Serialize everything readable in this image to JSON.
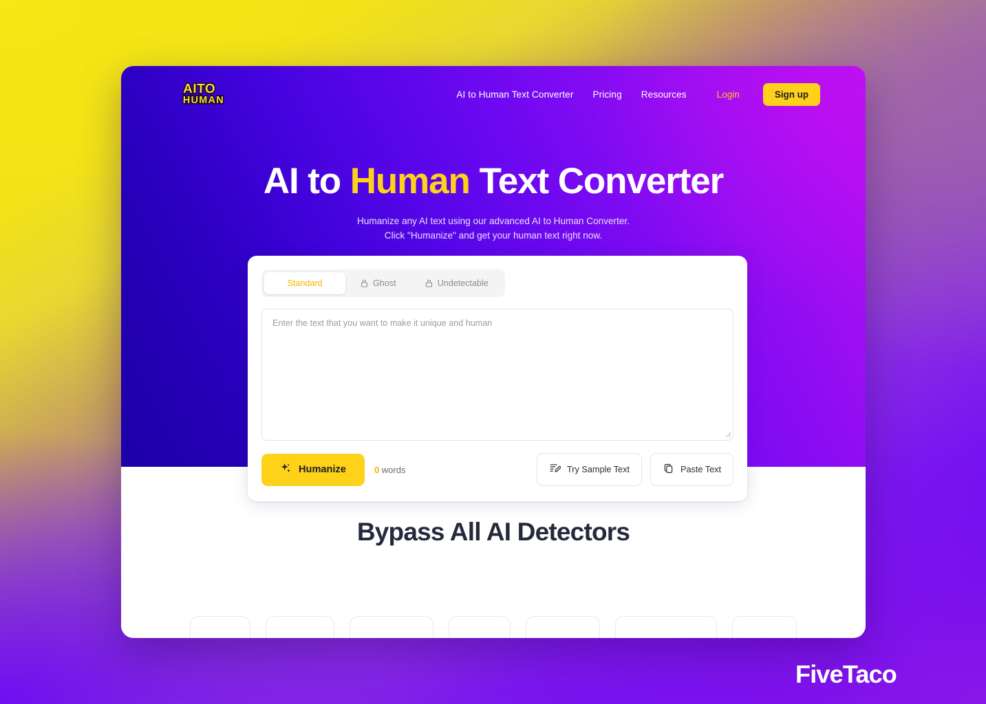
{
  "background": {
    "gradient_from": "#f2e317",
    "gradient_to": "#6205ef"
  },
  "watermark": {
    "text": "FiveTaco"
  },
  "site": {
    "logo": {
      "line1": "AITO",
      "line2": "HUMAN",
      "color": "#ffd83a"
    },
    "nav": {
      "links": [
        {
          "label": "AI to Human Text Converter"
        },
        {
          "label": "Pricing"
        },
        {
          "label": "Resources"
        }
      ],
      "login_label": "Login",
      "signup_label": "Sign up",
      "accent_color": "#ffd21a"
    }
  },
  "hero": {
    "heading_part1": "AI to ",
    "heading_highlight": "Human",
    "heading_part2": " Text Converter",
    "highlight_color": "#ffd21a",
    "subtitle_line1": "Humanize any AI text using our advanced AI to Human Converter.",
    "subtitle_line2": "Click \"Humanize\" and get your human text right now."
  },
  "converter": {
    "tabs": [
      {
        "label": "Standard",
        "locked": false,
        "active": true
      },
      {
        "label": "Ghost",
        "locked": true,
        "active": false
      },
      {
        "label": "Undetectable",
        "locked": true,
        "active": false
      }
    ],
    "input": {
      "placeholder": "Enter the text that you want to make it unique and human",
      "value": ""
    },
    "humanize_label": "Humanize",
    "word_count_number": "0",
    "word_count_label": " words",
    "sample_label": "Try Sample Text",
    "paste_label": "Paste Text"
  },
  "section_detectors": {
    "heading": "Bypass All AI Detectors",
    "chip_widths": [
      88,
      100,
      122,
      90,
      108,
      148,
      94
    ]
  }
}
